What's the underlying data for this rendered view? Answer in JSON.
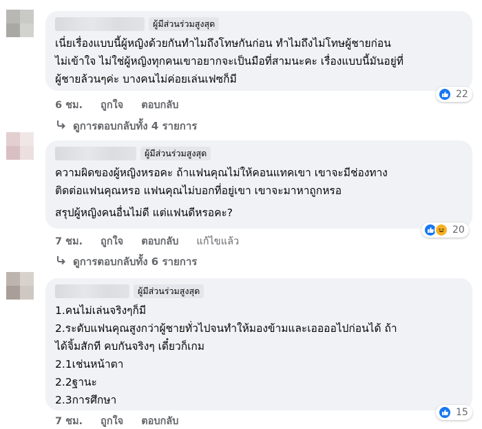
{
  "comments": [
    {
      "badge": "ผู้มีส่วนร่วมสูงสุด",
      "lines": [
        "เนี่ยเรื่องแบบนี้ผู้หญิงด้วยกันทำไมถึงโทษกันก่อน ทำไมถึงไม่โทษผู้ชายก่อน",
        "ไม่เข้าใจ ไม่ใช่ผู้หญิงทุกคนเขาอยากจะเป็นมือที่สามนะคะ เรื่องแบบนี้มันอยู่ที่",
        "ผู้ชายล้วนๆค่ะ บางคนไม่ค่อยเล่นเฟซก็มี"
      ],
      "time": "6 ชม.",
      "like": "ถูกใจ",
      "reply": "ตอบกลับ",
      "reaction_count": "22",
      "view_replies": "ดูการตอบกลับทั้ง 4 รายการ"
    },
    {
      "badge": "ผู้มีส่วนร่วมสูงสุด",
      "lines": [
        "ความผิดของผู้หญิงหรอคะ ถ้าแฟนคุณไม่ให้คอนแทคเขา เขาจะมีช่องทาง",
        "ติดต่อแฟนคุณหรอ แฟนคุณไม่บอกที่อยู่เขา เขาจะมาหาถูกหรอ"
      ],
      "lines2": [
        "สรุปผู้หญิงคนอื่นไม่ดี แต่แฟนดีหรอคะ?"
      ],
      "time": "7 ชม.",
      "like": "ถูกใจ",
      "reply": "ตอบกลับ",
      "edited": "แก้ไขแล้ว",
      "reaction_count": "20",
      "view_replies": "ดูการตอบกลับทั้ง 6 รายการ"
    },
    {
      "badge": "ผู้มีส่วนร่วมสูงสุด",
      "lines": [
        "1.คนไม่เล่นจริงๆก็มี",
        "2.ระดับแฟนคุณสูงกว่าผู้ชายทั่วไปจนทำให้มองข้ามและเออออไปก่อนได้ ถ้า",
        "ได้จิ้มสักที คบกันจริงๆ เดี๋ยวก็เกม",
        "2.1เช่นหน้าตา",
        "2.2ฐานะ",
        "2.3การศึกษา"
      ],
      "time": "7 ชม.",
      "like": "ถูกใจ",
      "reply": "ตอบกลับ",
      "reaction_count": "15"
    }
  ],
  "icons": {
    "like": "like-reaction-icon",
    "haha": "haha-reaction-icon",
    "reply_arrow": "reply-arrow-icon"
  },
  "colors": {
    "bubble": "#f0f2f5",
    "muted": "#65676b",
    "like_blue": "#1877f2",
    "haha_yellow": "#f7b125"
  }
}
